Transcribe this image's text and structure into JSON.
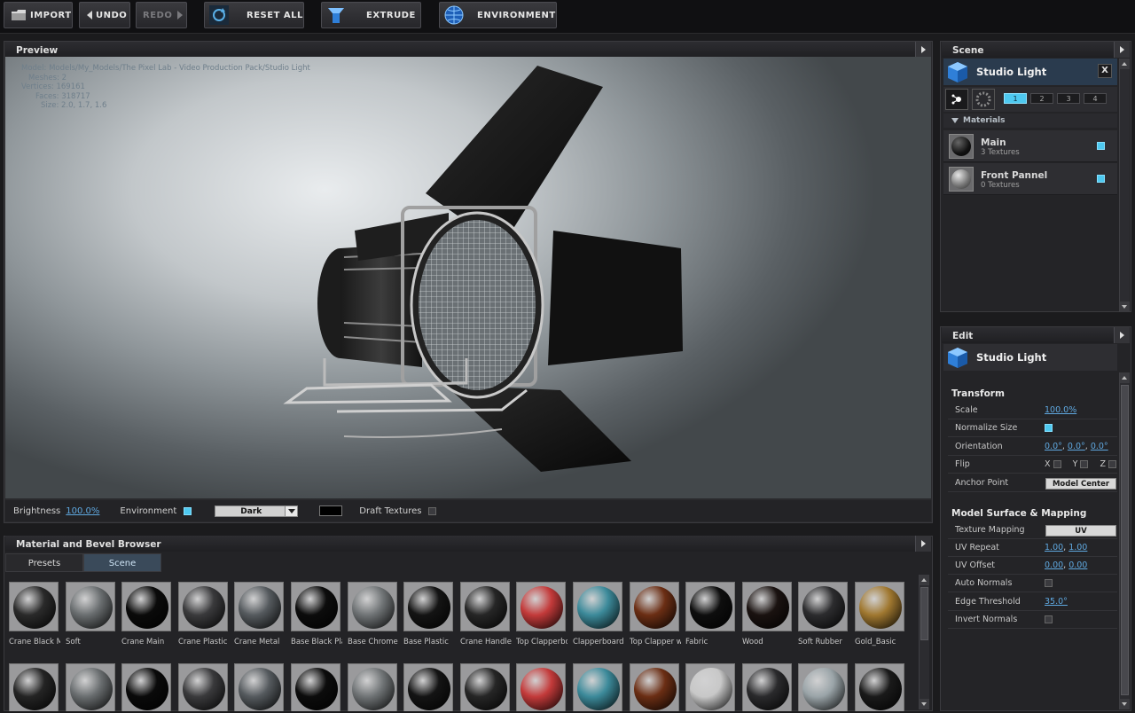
{
  "toolbar": {
    "import": "IMPORT",
    "undo": "UNDO",
    "redo": "REDO",
    "reset_all": "RESET ALL",
    "extrude": "EXTRUDE",
    "environment": "ENVIRONMENT"
  },
  "preview": {
    "title": "Preview",
    "info": {
      "model": "Model: Models/My_Models/The Pixel Lab - Video Production Pack/Studio Light",
      "meshes": "Meshes: 2",
      "vertices": "Vertices: 169161",
      "faces": "Faces: 318717",
      "size": "Size: 2.0, 1.7, 1.6"
    },
    "brightness_label": "Brightness",
    "brightness_value": "100.0%",
    "environment_label": "Environment",
    "environment_value": "Dark",
    "draft_textures_label": "Draft Textures"
  },
  "browser": {
    "title": "Material and Bevel Browser",
    "tabs": [
      "Presets",
      "Scene"
    ],
    "row1": [
      {
        "label": "Crane Black M",
        "color": "#2a2a2a"
      },
      {
        "label": "Soft",
        "color": "#6a6e70"
      },
      {
        "label": "Crane Main",
        "color": "#0a0a0a"
      },
      {
        "label": "Crane Plastic",
        "color": "#3a3a3c"
      },
      {
        "label": "Crane Metal",
        "color": "#555a5e"
      },
      {
        "label": "Base Black Pla",
        "color": "#0c0c0c"
      },
      {
        "label": "Base Chrome",
        "color": "#707476"
      },
      {
        "label": "Base Plastic",
        "color": "#141414"
      },
      {
        "label": "Crane Handle",
        "color": "#262626"
      },
      {
        "label": "Top Clapperbo",
        "color": "#c33a3a"
      },
      {
        "label": "Clapperboard",
        "color": "#3c8a9a"
      },
      {
        "label": "Top Clapper w",
        "color": "#6b2e14"
      },
      {
        "label": "Fabric",
        "color": "#0e0e0e"
      },
      {
        "label": "Wood",
        "color": "#1a1210"
      },
      {
        "label": "Soft Rubber",
        "color": "#2c2c2e"
      },
      {
        "label": "Gold_Basic",
        "color": "#a07830"
      }
    ],
    "row2_colors": [
      "#242424",
      "#6a6e70",
      "#0a0a0a",
      "#3a3a3c",
      "#555a5e",
      "#0c0c0c",
      "#707476",
      "#141414",
      "#262626",
      "#c33a3a",
      "#3c8a9a",
      "#6b2e14",
      "#c8c8c8",
      "#2a2a2c",
      "#9aa4a8",
      "#1a1a1a"
    ]
  },
  "scene": {
    "title": "Scene",
    "object_name": "Studio Light",
    "close": "X",
    "layers": [
      "1",
      "2",
      "3",
      "4"
    ],
    "materials_label": "Materials",
    "materials": [
      {
        "name": "Main",
        "textures": "3 Textures"
      },
      {
        "name": "Front Pannel",
        "textures": "0 Textures"
      }
    ]
  },
  "edit": {
    "title": "Edit",
    "object_name": "Studio Light",
    "transform": {
      "title": "Transform",
      "scale_label": "Scale",
      "scale_value": "100.0%",
      "normalize_label": "Normalize Size",
      "orientation_label": "Orientation",
      "orientation_values": [
        "0.0°",
        "0.0°",
        "0.0°"
      ],
      "flip_label": "Flip",
      "flip_axes": [
        "X",
        "Y",
        "Z"
      ],
      "anchor_label": "Anchor Point",
      "anchor_value": "Model Center"
    },
    "surface": {
      "title": "Model Surface & Mapping",
      "texture_mapping_label": "Texture Mapping",
      "texture_mapping_value": "UV",
      "uv_repeat_label": "UV Repeat",
      "uv_repeat_values": [
        "1.00",
        "1.00"
      ],
      "uv_offset_label": "UV Offset",
      "uv_offset_values": [
        "0.00",
        "0.00"
      ],
      "auto_normals_label": "Auto Normals",
      "edge_threshold_label": "Edge Threshold",
      "edge_threshold_value": "35.0°",
      "invert_normals_label": "Invert Normals"
    }
  }
}
